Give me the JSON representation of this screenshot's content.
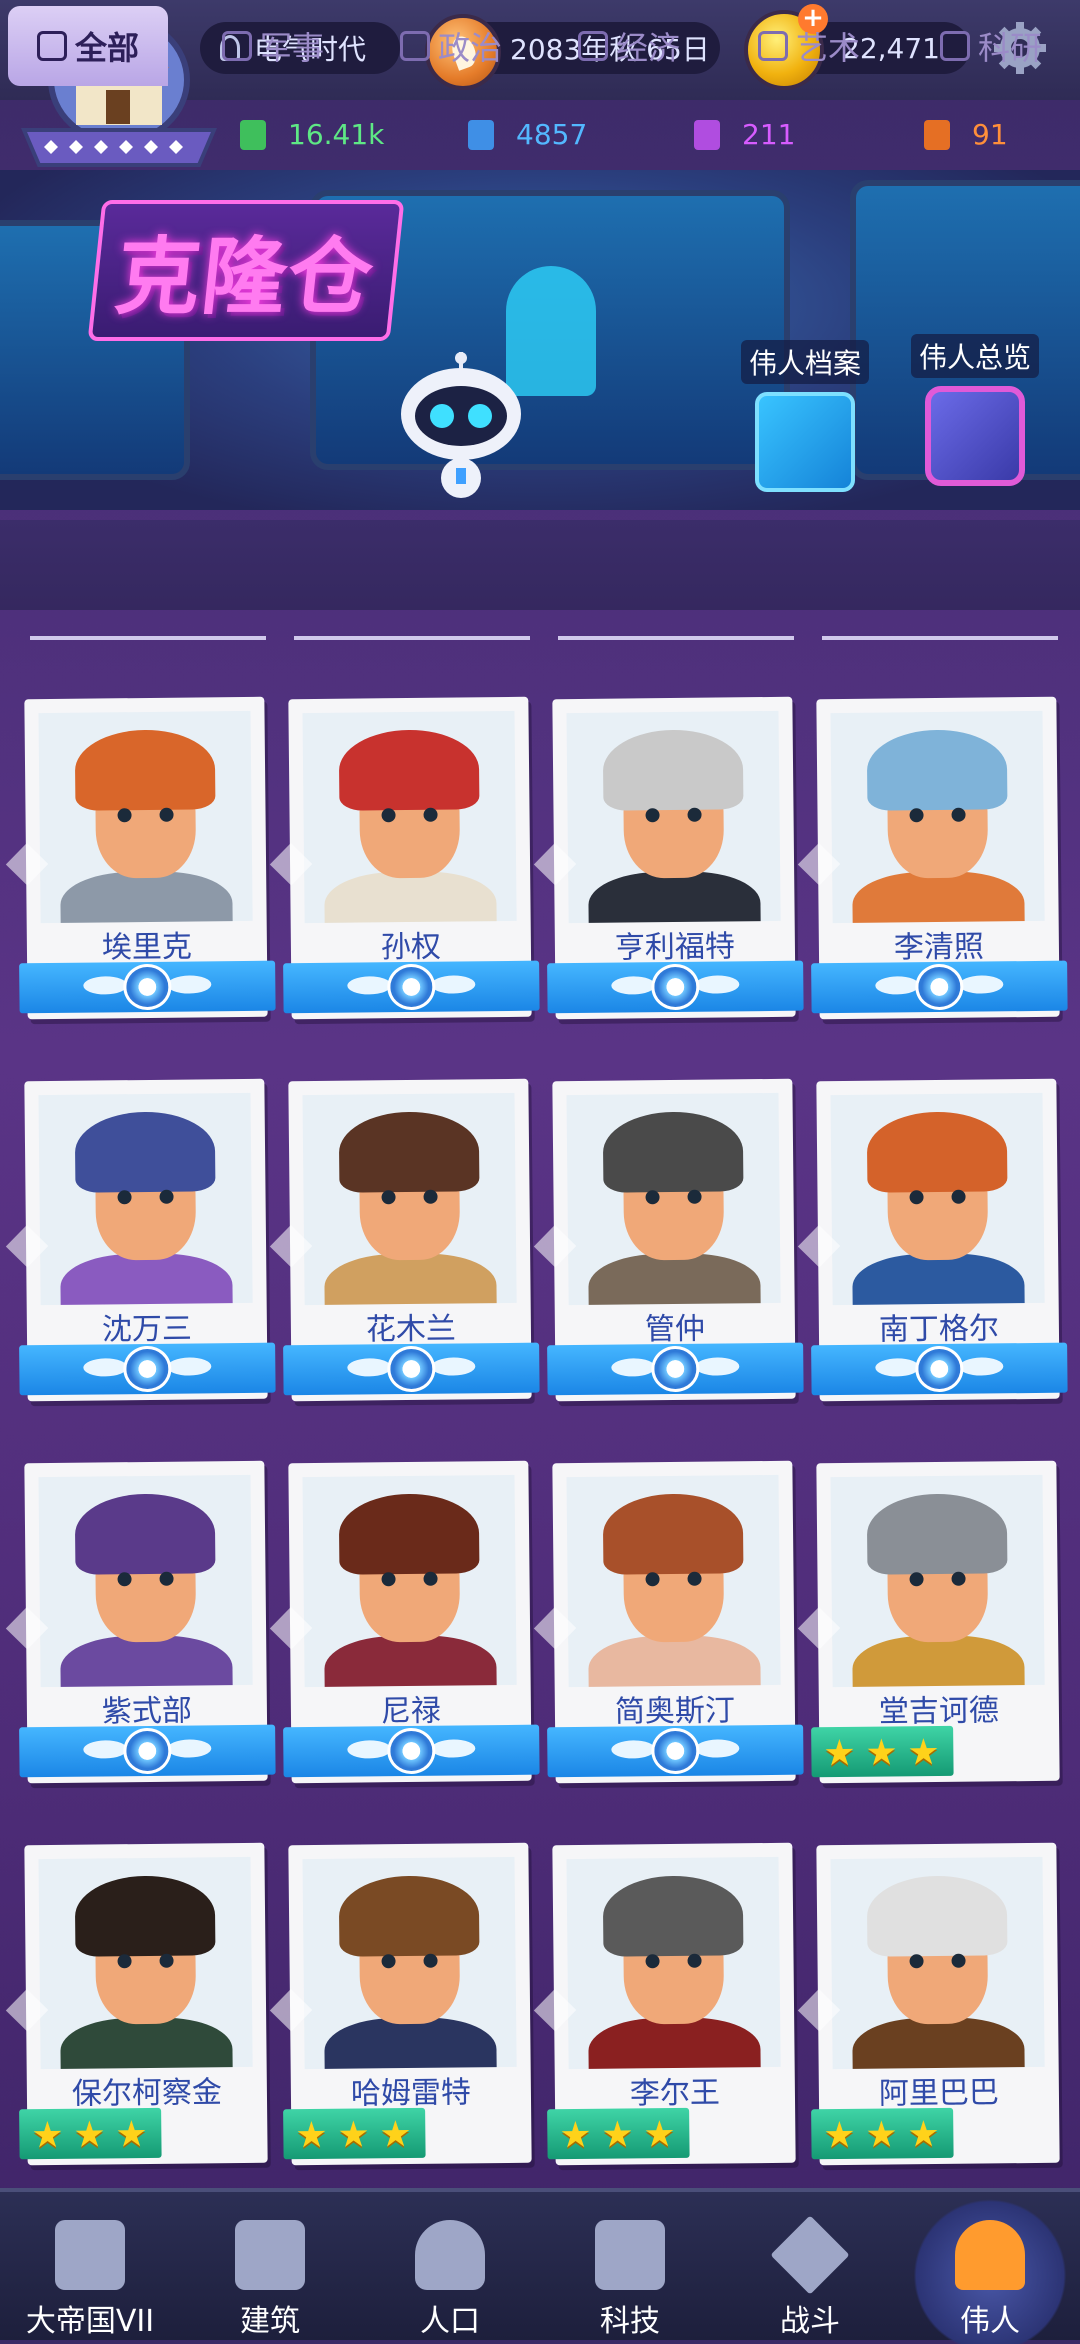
{
  "topbar": {
    "age": "电气时代",
    "date": "2083年秋 65日",
    "gold": "22,471"
  },
  "resources": [
    {
      "value": "16.41k",
      "color": "#5ee885"
    },
    {
      "value": "4857",
      "color": "#53b8ff"
    },
    {
      "value": "211",
      "color": "#d75cff"
    },
    {
      "value": "91",
      "color": "#ff8f3a"
    }
  ],
  "banner": {
    "title": "克隆仓",
    "shortcut_archive": "伟人档案",
    "shortcut_overview": "伟人总览"
  },
  "tabs": [
    {
      "label": "全部",
      "active": true
    },
    {
      "label": "军事"
    },
    {
      "label": "政治"
    },
    {
      "label": "经济"
    },
    {
      "label": "艺术"
    },
    {
      "label": "科研"
    }
  ],
  "heroes": [
    {
      "name": "埃里克",
      "rank": "badge",
      "hair": "#d9662a",
      "body": "#8d99a8"
    },
    {
      "name": "孙权",
      "rank": "badge",
      "hair": "#c8322e",
      "body": "#e8e0d0"
    },
    {
      "name": "亨利福特",
      "rank": "badge",
      "hair": "#c9c9c9",
      "body": "#2a2f3a"
    },
    {
      "name": "李清照",
      "rank": "badge",
      "hair": "#7fb3d9",
      "body": "#e07a3a"
    },
    {
      "name": "沈万三",
      "rank": "badge",
      "hair": "#3f4f9a",
      "body": "#8a5bc0"
    },
    {
      "name": "花木兰",
      "rank": "badge",
      "hair": "#5a3424",
      "body": "#d0a060"
    },
    {
      "name": "管仲",
      "rank": "badge",
      "hair": "#4a4a4a",
      "body": "#7a6a5a"
    },
    {
      "name": "南丁格尔",
      "rank": "badge",
      "hair": "#d4622a",
      "body": "#2c5aa0"
    },
    {
      "name": "紫式部",
      "rank": "badge",
      "hair": "#5a3a8a",
      "body": "#6b4aa0"
    },
    {
      "name": "尼禄",
      "rank": "badge",
      "hair": "#6a2a1a",
      "body": "#8a2a3a"
    },
    {
      "name": "简奥斯汀",
      "rank": "badge",
      "hair": "#a8502a",
      "body": "#e8b8a0"
    },
    {
      "name": "堂吉诃德",
      "rank": "stars",
      "hair": "#8a8f96",
      "body": "#d09a3a"
    },
    {
      "name": "保尔柯察金",
      "rank": "stars",
      "hair": "#2a1f1a",
      "body": "#2f4a3a"
    },
    {
      "name": "哈姆雷特",
      "rank": "stars",
      "hair": "#7a4a24",
      "body": "#2a3560"
    },
    {
      "name": "李尔王",
      "rank": "stars",
      "hair": "#5a5a5a",
      "body": "#8a2020"
    },
    {
      "name": "阿里巴巴",
      "rank": "stars",
      "hair": "#e0e0e0",
      "body": "#6a4020"
    }
  ],
  "nav": [
    {
      "label": "大帝国VII"
    },
    {
      "label": "建筑"
    },
    {
      "label": "人口"
    },
    {
      "label": "科技"
    },
    {
      "label": "战斗"
    },
    {
      "label": "伟人",
      "active": true
    }
  ]
}
